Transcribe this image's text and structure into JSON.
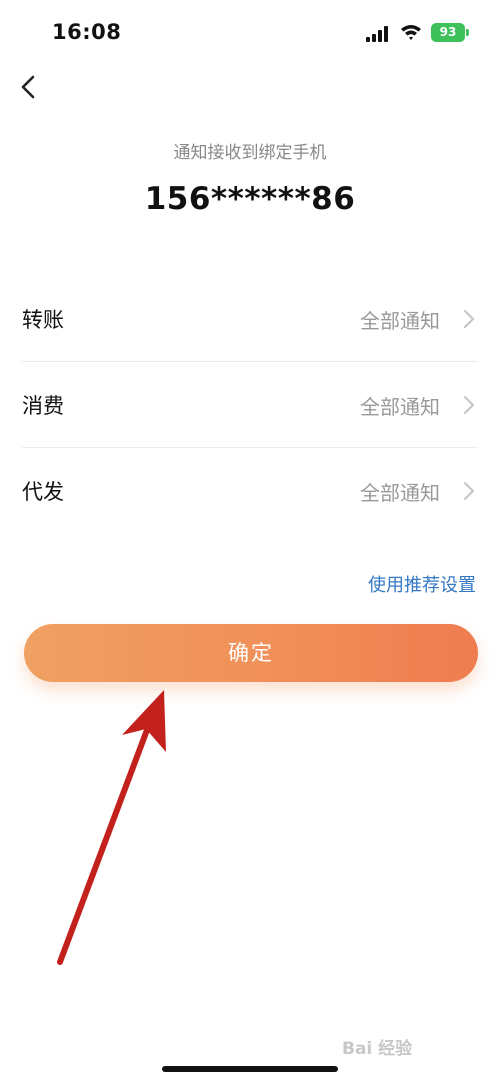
{
  "status_bar": {
    "time": "16:08",
    "battery": "93",
    "icons": [
      "cellular-signal-icon",
      "wifi-icon",
      "battery-charging-icon"
    ]
  },
  "header": {
    "back_icon": "chevron-left-icon"
  },
  "subtitle": "通知接收到绑定手机",
  "phone_number": "156******86",
  "rows": [
    {
      "label": "转账",
      "value": "全部通知"
    },
    {
      "label": "消费",
      "value": "全部通知"
    },
    {
      "label": "代发",
      "value": "全部通知"
    }
  ],
  "recommend_link": "使用推荐设置",
  "confirm_button": "确定",
  "watermark": "Bai 经验",
  "colors": {
    "accent_start": "#f0a062",
    "accent_end": "#ef7c4f",
    "link": "#3478c6",
    "annotation_arrow": "#c3211c",
    "battery": "#3ec15b"
  }
}
